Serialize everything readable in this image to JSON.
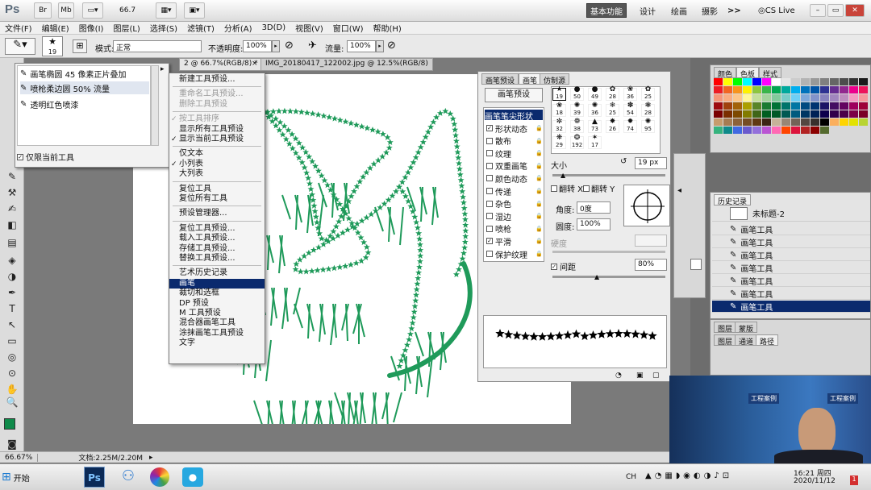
{
  "app": {
    "logo": "Ps",
    "mode_buttons": [
      "Br",
      "Mb"
    ],
    "zoom_value": "66.7",
    "workspaces": [
      "基本功能",
      "设计",
      "绘画",
      "摄影"
    ],
    "more_label": ">>",
    "cs_live": "CS Live"
  },
  "menu": [
    "文件(F)",
    "编辑(E)",
    "图像(I)",
    "图层(L)",
    "选择(S)",
    "滤镜(T)",
    "分析(A)",
    "3D(D)",
    "视图(V)",
    "窗口(W)",
    "帮助(H)"
  ],
  "options": {
    "brush_size": "19",
    "mode_label": "模式:",
    "mode_value": "正常",
    "opacity_label": "不透明度:",
    "opacity_value": "100%",
    "flow_label": "流量:",
    "flow_value": "100%"
  },
  "tabs": [
    {
      "label": "2 @ 66.7%(RGB/8) *"
    },
    {
      "label": "IMG_20180417_122002.jpg @ 12.5%(RGB/8)"
    }
  ],
  "tool_presets": {
    "items": [
      "画笔椭圆 45 像素正片叠加",
      "喷枪柔边圆 50% 流量",
      "透明红色喷漆"
    ],
    "checkbox_label": "仅限当前工具"
  },
  "context_menu": {
    "groups": [
      [
        {
          "label": "新建工具预设...",
          "disabled": false,
          "checked": false
        }
      ],
      [
        {
          "label": "重命名工具预设...",
          "disabled": true,
          "checked": false
        },
        {
          "label": "删除工具预设",
          "disabled": true,
          "checked": false
        }
      ],
      [
        {
          "label": "按工具排序",
          "disabled": true,
          "checked": true
        },
        {
          "label": "显示所有工具预设",
          "disabled": false,
          "checked": false
        },
        {
          "label": "显示当前工具预设",
          "disabled": false,
          "checked": true
        }
      ],
      [
        {
          "label": "仅文本",
          "disabled": false,
          "checked": false
        },
        {
          "label": "小列表",
          "disabled": false,
          "checked": true
        },
        {
          "label": "大列表",
          "disabled": false,
          "checked": false
        }
      ],
      [
        {
          "label": "复位工具",
          "disabled": false,
          "checked": false
        },
        {
          "label": "复位所有工具",
          "disabled": false,
          "checked": false
        }
      ],
      [
        {
          "label": "预设管理器...",
          "disabled": false,
          "checked": false
        }
      ],
      [
        {
          "label": "复位工具预设...",
          "disabled": false,
          "checked": false
        },
        {
          "label": "载入工具预设...",
          "disabled": false,
          "checked": false
        },
        {
          "label": "存储工具预设...",
          "disabled": false,
          "checked": false
        },
        {
          "label": "替换工具预设...",
          "disabled": false,
          "checked": false
        }
      ],
      [
        {
          "label": "艺术历史记录",
          "disabled": false,
          "checked": false
        },
        {
          "label": "画笔",
          "disabled": false,
          "checked": false,
          "selected": true
        },
        {
          "label": "裁切和选框",
          "disabled": false,
          "checked": false
        },
        {
          "label": "DP 预设",
          "disabled": false,
          "checked": false
        },
        {
          "label": "M 工具预设",
          "disabled": false,
          "checked": false
        },
        {
          "label": "混合器画笔工具",
          "disabled": false,
          "checked": false
        },
        {
          "label": "涂抹画笔工具预设",
          "disabled": false,
          "checked": false
        },
        {
          "label": "文字",
          "disabled": false,
          "checked": false
        }
      ]
    ]
  },
  "brush_panel": {
    "tabs": [
      "画笔预设",
      "画笔",
      "仿制源"
    ],
    "preset_button": "画笔预设",
    "tip_shape": "画笔笔尖形状",
    "options": [
      {
        "label": "形状动态",
        "checked": true
      },
      {
        "label": "散布",
        "checked": false
      },
      {
        "label": "纹理",
        "checked": false
      },
      {
        "label": "双重画笔",
        "checked": false
      },
      {
        "label": "颜色动态",
        "checked": false
      },
      {
        "label": "传递",
        "checked": false
      },
      {
        "label": "杂色",
        "checked": false
      },
      {
        "label": "湿边",
        "checked": false
      },
      {
        "label": "喷枪",
        "checked": false
      },
      {
        "label": "平滑",
        "checked": true
      },
      {
        "label": "保护纹理",
        "checked": false
      }
    ],
    "sizes": [
      "19",
      "50",
      "49",
      "28",
      "36",
      "25",
      "18",
      "39",
      "36",
      "25",
      "54",
      "28",
      "32",
      "38",
      "73",
      "26",
      "74",
      "95",
      "29",
      "192",
      "17"
    ],
    "size_label": "大小",
    "size_value": "19 px",
    "flipx": "翻转 X",
    "flipy": "翻转 Y",
    "angle_label": "角度:",
    "angle_value": "0度",
    "round_label": "圆度:",
    "round_value": "100%",
    "hardness_label": "硬度",
    "spacing_label": "间距",
    "spacing_value": "80%"
  },
  "swatches": {
    "tabs": [
      "颜色",
      "色板",
      "样式"
    ],
    "colors": [
      "#ff0000",
      "#ffff00",
      "#00ff00",
      "#00ffff",
      "#0000ff",
      "#ff00ff",
      "#ffffff",
      "#e6e6e6",
      "#cccccc",
      "#b3b3b3",
      "#999999",
      "#808080",
      "#666666",
      "#4d4d4d",
      "#333333",
      "#1a1a1a",
      "#ed1c24",
      "#f26522",
      "#f7941d",
      "#fff200",
      "#8dc63f",
      "#39b54a",
      "#00a651",
      "#00a99d",
      "#00aeef",
      "#0072bc",
      "#0054a6",
      "#2e3192",
      "#662d91",
      "#92278f",
      "#ec008c",
      "#ed145b",
      "#f69679",
      "#f9ad81",
      "#fdc689",
      "#fff799",
      "#c4df9b",
      "#a3d39c",
      "#82ca9c",
      "#7accc8",
      "#6dcff6",
      "#7da7d9",
      "#8393ca",
      "#8781bd",
      "#a186be",
      "#bd8cbf",
      "#f49ac2",
      "#f6989d",
      "#9e0b0f",
      "#a0410d",
      "#a3620a",
      "#aba000",
      "#598527",
      "#197b30",
      "#007236",
      "#00746b",
      "#0076a3",
      "#004a80",
      "#003471",
      "#1b1464",
      "#440e62",
      "#630460",
      "#9e005d",
      "#9e0039",
      "#790000",
      "#7b2e00",
      "#7d4900",
      "#827b00",
      "#406618",
      "#005e20",
      "#005826",
      "#005952",
      "#005b7f",
      "#003663",
      "#002157",
      "#0d004c",
      "#32004b",
      "#4b0049",
      "#7b0046",
      "#7a0026",
      "#c69c6d",
      "#a67c52",
      "#8c6239",
      "#754c24",
      "#603913",
      "#3c2415",
      "#c7b299",
      "#998675",
      "#736357",
      "#534741",
      "#37302d",
      "#000000",
      "#fbaf5d",
      "#ffd400",
      "#e2e200",
      "#b8d432",
      "#36b37e",
      "#0e8a8a",
      "#4169e1",
      "#6a5acd",
      "#9370db",
      "#ba55d3",
      "#ff69b4",
      "#ff4500",
      "#dc143c",
      "#b22222",
      "#8b0000",
      "#556b2f"
    ]
  },
  "history": {
    "title": "历史记录",
    "snapshot": "未标题-2",
    "items": [
      "画笔工具",
      "画笔工具",
      "画笔工具",
      "画笔工具",
      "画笔工具",
      "画笔工具",
      "画笔工具"
    ]
  },
  "layers": {
    "tabs1": [
      "图层",
      "蒙版"
    ],
    "tabs2": [
      "图层",
      "通道",
      "路径"
    ]
  },
  "status": {
    "zoom": "66.67%",
    "doc": "文档:2.25M/2.20M"
  },
  "taskbar": {
    "start": "开始",
    "lang": "CH",
    "time": "16:21 周四",
    "date": "2020/11/12"
  },
  "webcam": {
    "sign1": "工程案例",
    "sign2": "工程案例"
  },
  "colors": {
    "fg": "#0f8a4a",
    "brush": "#1f9a5a"
  }
}
